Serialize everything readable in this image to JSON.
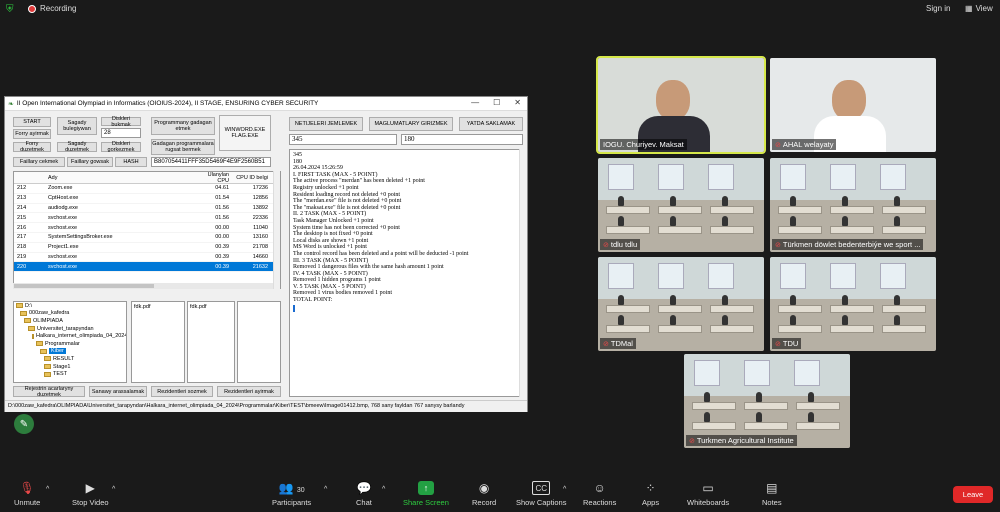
{
  "topbar": {
    "recording": "Recording",
    "sign_in": "Sign in",
    "view": "View"
  },
  "app": {
    "title": "II Open International Olympiad in Informatics (OIOIUS-2024), II STAGE, ENSURING CYBER SECURITY",
    "buttons": {
      "start": "START",
      "sagady": "Sagady bulegiywan",
      "diskleri_bukmak": "Diskleri bukmak",
      "programmany": "Programmany gadagan etmek",
      "winword": "WINWORD.EXE FLAG.EXE",
      "forry_ayirmak": "Forry ayirmak",
      "forry_duzetmek": "Forry duzetmek",
      "sagady_duzetmek": "Sagady duzetmek",
      "diskleri_gorkezmek": "Diskleri gorkezmek",
      "gadagan_programmalara": "Gadagan programmalara rugsat bermek",
      "faillary_cekmek": "Faillary cekmek",
      "faillary_gowsak": "Faillary gowsak",
      "hash": "HASH",
      "netijeleri": "NETIJELERI JEMLEMEK",
      "maglumatlary": "MAGLUMATLARY GIRIZMEK",
      "yatda": "YATDA SAKLAMAK",
      "rejestr": "Rejestrin acarlaryny duzetmek",
      "sanawy": "Sanawy arassalamak",
      "rezidentleri_sozmek": "Rezidentleri sozmek",
      "rezidentleri_ayirmak": "Rezidentleri ayirmak"
    },
    "field_28": "28",
    "hash_value": "B807054411FFF35D5469F4E9F2560B51",
    "score_left": "345",
    "score_right": "180",
    "grid_headers": [
      "",
      "Ady",
      "Ulanylan CPU",
      "CPU ID belgi"
    ],
    "grid_rows": [
      [
        "212",
        "Zoom.exe",
        "04.61",
        "17236"
      ],
      [
        "213",
        "CptHost.exe",
        "01.54",
        "12856"
      ],
      [
        "214",
        "audiodg.exe",
        "01.56",
        "13892"
      ],
      [
        "215",
        "svchost.exe",
        "01.56",
        "22336"
      ],
      [
        "216",
        "svchost.exe",
        "00.00",
        "11040"
      ],
      [
        "217",
        "SystemSettingsBroker.exe",
        "00.00",
        "13160"
      ],
      [
        "218",
        "Project1.exe",
        "00.39",
        "21708"
      ],
      [
        "219",
        "svchost.exe",
        "00.39",
        "14660"
      ],
      [
        "220",
        "svchost.exe",
        "00.39",
        "21632"
      ]
    ],
    "tree": [
      {
        "label": "D:\\",
        "indent": 0
      },
      {
        "label": "000zaw_kafedra",
        "indent": 1
      },
      {
        "label": "OLIMPIADA",
        "indent": 2
      },
      {
        "label": "Universitet_tarapyndan",
        "indent": 3
      },
      {
        "label": "Halkara_internet_olimpiada_04_2024",
        "indent": 4
      },
      {
        "label": "Programmalar",
        "indent": 5
      },
      {
        "label": "Kiber",
        "indent": 6,
        "selected": true
      },
      {
        "label": "RESULT",
        "indent": 7
      },
      {
        "label": "Stage1",
        "indent": 7
      },
      {
        "label": "TEST",
        "indent": 7
      }
    ],
    "list_files": [
      "fdk.pdf",
      "fdk.pdf"
    ],
    "log_lines": [
      "345",
      "180",
      "26.04.2024 15:26:59",
      "I. FIRST TASK (MAX - 5 POINT)",
      "The active process \"merdan\" has been deleted +1 point",
      "Registry unlocked +1 point",
      "Resident loading record not deleted +0 point",
      "The \"merdan.exe\" file is not deleted +0 point",
      "The \"maksat.exe\" file is not deleted +0 point",
      "II. 2 TASK (MAX - 5 POINT)",
      "Task Manager Unlocked +1 point",
      "System time has not been corrected +0 point",
      "The desktop is not fixed +0 point",
      "Local disks are shown +1 point",
      "MS Word is unlocked +1 point",
      "The control record has been deleted and a point will be deducted -1 point",
      "III. 3 TASK (MAX - 5 POINT)",
      "Removed 1 dangerous files with the same hash amount 1 point",
      "IV. 4 TASK (MAX - 5 POINT)",
      "Removed 1 hidden programs 1 point",
      "V. 5 TASK (MAX - 5 POINT)",
      "Removed 1 virus bodies removed 1 point",
      "TOTAL POINT:"
    ],
    "status": "D:\\000zaw_kafedra\\OLIMPIADA\\Universitet_tarapyndan\\Halkara_internet_olimpiada_04_2024\\Programmalar\\Kiber\\TEST\\bmeew\\Image01412.bmp, 768 sany fayldan 767 sanysy barlandy"
  },
  "participants": [
    {
      "name": "IOGU. Churiyev. Maksat",
      "muted": false,
      "active": true
    },
    {
      "name": "AHAL welayaty",
      "muted": true,
      "active": false
    },
    {
      "name": "tdlu tdlu",
      "muted": true,
      "active": false
    },
    {
      "name": "Türkmen döwlet bedenterbiýe we sport ...",
      "muted": true,
      "active": false
    },
    {
      "name": "TDMal",
      "muted": true,
      "active": false
    },
    {
      "name": "TDU",
      "muted": true,
      "active": false
    },
    {
      "name": "Turkmen Agricultural Institute",
      "muted": true,
      "active": false
    }
  ],
  "toolbar": {
    "unmute": "Unmute",
    "stop_video": "Stop Video",
    "participants": "Participants",
    "participants_count": "30",
    "chat": "Chat",
    "share_screen": "Share Screen",
    "record": "Record",
    "show_captions": "Show Captions",
    "reactions": "Reactions",
    "apps": "Apps",
    "whiteboards": "Whiteboards",
    "notes": "Notes",
    "leave": "Leave"
  },
  "colors": {
    "leave": "#e02828",
    "share": "#23a043",
    "active_outline": "#d6e84a"
  }
}
